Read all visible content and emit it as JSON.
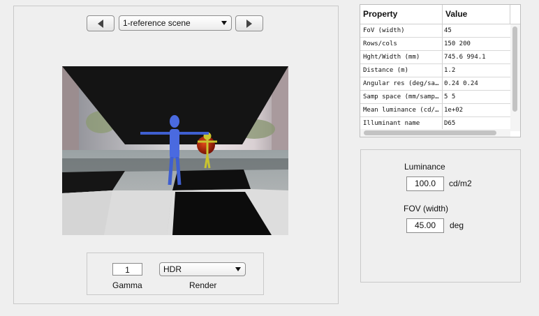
{
  "scene": {
    "selected": "1-reference scene",
    "prev_icon": "left-triangle-icon",
    "next_icon": "right-triangle-icon"
  },
  "display": {
    "gamma_value": "1",
    "gamma_label": "Gamma",
    "render_selected": "HDR",
    "render_label": "Render"
  },
  "table": {
    "headers": [
      "Property",
      "Value"
    ],
    "rows": [
      {
        "property": "FoV (width)",
        "value": "45"
      },
      {
        "property": "Rows/cols",
        "value": "150 200"
      },
      {
        "property": "Hght/Width (mm)",
        "value": "745.6 994.1"
      },
      {
        "property": "Distance (m)",
        "value": "1.2"
      },
      {
        "property": "Angular res (deg/sa…",
        "value": "0.24 0.24"
      },
      {
        "property": "Samp space (mm/samp…",
        "value": "5 5"
      },
      {
        "property": "Mean luminance (cd/…",
        "value": "1e+02"
      },
      {
        "property": "Illuminant name",
        "value": "D65"
      }
    ]
  },
  "params": {
    "luminance_label": "Luminance",
    "luminance_value": "100.0",
    "luminance_unit": "cd/m2",
    "fov_label": "FOV (width)",
    "fov_value": "45.00",
    "fov_unit": "deg"
  }
}
